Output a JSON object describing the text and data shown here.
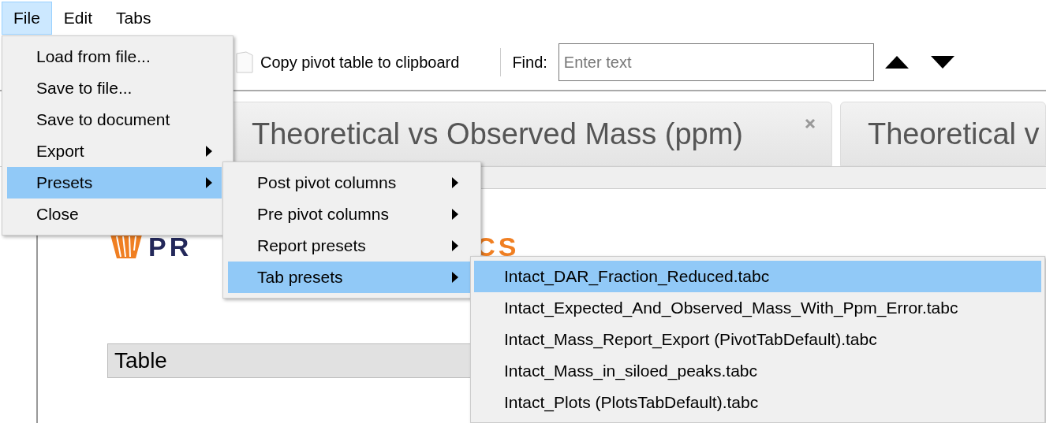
{
  "menubar": [
    {
      "label": "File",
      "selected": true
    },
    {
      "label": "Edit",
      "selected": false
    },
    {
      "label": "Tabs",
      "selected": false
    }
  ],
  "toolbar": {
    "copy_label": "Copy pivot table to clipboard",
    "find_label": "Find:",
    "find_placeholder": "Enter text"
  },
  "tabs": [
    {
      "title": "Theoretical vs Observed Mass (ppm)",
      "closable": true
    },
    {
      "title": "Theoretical v",
      "closable": false
    }
  ],
  "logo": {
    "left_text": "PR",
    "right_text": "CS"
  },
  "view_select": {
    "value": "Table"
  },
  "file_menu": [
    {
      "label": "Load from file...",
      "submenu": false,
      "selected": false
    },
    {
      "label": "Save to file...",
      "submenu": false,
      "selected": false
    },
    {
      "label": "Save to document",
      "submenu": false,
      "selected": false
    },
    {
      "label": "Export",
      "submenu": true,
      "selected": false
    },
    {
      "label": "Presets",
      "submenu": true,
      "selected": true
    },
    {
      "label": "Close",
      "submenu": false,
      "selected": false
    }
  ],
  "presets_menu": [
    {
      "label": "Post pivot columns",
      "submenu": true,
      "selected": false
    },
    {
      "label": "Pre pivot columns",
      "submenu": true,
      "selected": false
    },
    {
      "label": "Report presets",
      "submenu": true,
      "selected": false
    },
    {
      "label": "Tab presets",
      "submenu": true,
      "selected": true
    }
  ],
  "tab_presets_menu": [
    {
      "label": "Intact_DAR_Fraction_Reduced.tabc",
      "submenu": false,
      "selected": true
    },
    {
      "label": "Intact_Expected_And_Observed_Mass_With_Ppm_Error.tabc",
      "submenu": false,
      "selected": false
    },
    {
      "label": "Intact_Mass_Report_Export (PivotTabDefault).tabc",
      "submenu": false,
      "selected": false
    },
    {
      "label": "Intact_Mass_in_siloed_peaks.tabc",
      "submenu": false,
      "selected": false
    },
    {
      "label": "Intact_Plots (PlotsTabDefault).tabc",
      "submenu": false,
      "selected": false
    }
  ]
}
